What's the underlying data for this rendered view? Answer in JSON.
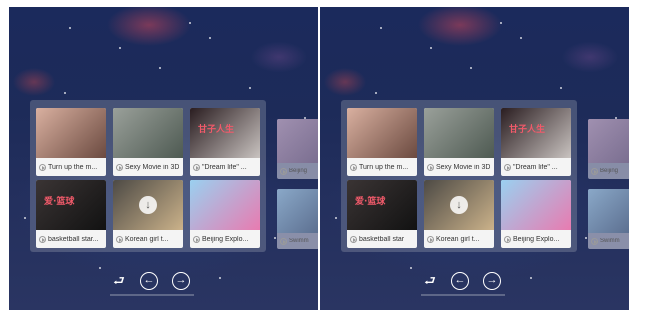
{
  "eyes": [
    {
      "videos": [
        {
          "title": "Turn up the m...",
          "colors": [
            "#d9b0a0",
            "#6b4a40"
          ]
        },
        {
          "title": "Sexy Movie in 3D",
          "colors": [
            "#9aa09a",
            "#4e5a52"
          ]
        },
        {
          "title": "\"Dream life\" ...",
          "colors": [
            "#2a1d20",
            "#c9c3c0"
          ],
          "thumb_text": "甘子人生"
        },
        {
          "title": "basketball star...",
          "colors": [
            "#3a3434",
            "#121212"
          ],
          "thumb_text": "爱·篮球"
        },
        {
          "title": "Korean girl t...",
          "colors": [
            "#4d4a45",
            "#cbb28a"
          ],
          "download": true
        },
        {
          "title": "Beijing Explo...",
          "colors": [
            "#9ad0f0",
            "#e87bb0"
          ]
        }
      ],
      "side_tiles": [
        {
          "title": "Beijing",
          "colors": [
            "#a090b0",
            "#7a6e90"
          ]
        },
        {
          "title": "Swimm",
          "colors": [
            "#8aa8c8",
            "#5c6f90"
          ]
        }
      ]
    },
    {
      "videos": [
        {
          "title": "Turn up the m...",
          "colors": [
            "#d9b0a0",
            "#6b4a40"
          ]
        },
        {
          "title": "Sexy Movie in 3D",
          "colors": [
            "#9aa09a",
            "#4e5a52"
          ]
        },
        {
          "title": "\"Dream life\" ...",
          "colors": [
            "#2a1d20",
            "#c9c3c0"
          ],
          "thumb_text": "甘子人生"
        },
        {
          "title": "basketball star",
          "colors": [
            "#3a3434",
            "#121212"
          ],
          "thumb_text": "爱·篮球"
        },
        {
          "title": "Korean girl t...",
          "colors": [
            "#4d4a45",
            "#cbb28a"
          ],
          "download": true
        },
        {
          "title": "Beijing Explo...",
          "colors": [
            "#9ad0f0",
            "#e87bb0"
          ]
        }
      ],
      "side_tiles": [
        {
          "title": "Beijing",
          "colors": [
            "#a090b0",
            "#7a6e90"
          ]
        },
        {
          "title": "Swimm",
          "colors": [
            "#8aa8c8",
            "#5c6f90"
          ]
        }
      ]
    }
  ],
  "controls": {
    "back_icon": "return-arrow-icon",
    "prev_icon": "arrow-left-circle-icon",
    "next_icon": "arrow-right-circle-icon"
  }
}
